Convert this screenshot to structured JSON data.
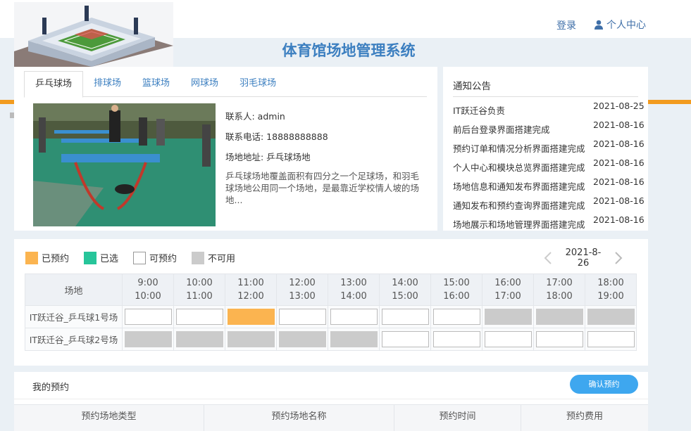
{
  "header": {
    "site_title": "体育馆场地管理系统",
    "login_label": "登录",
    "user_center_label": "个人中心"
  },
  "venue": {
    "tabs": [
      {
        "label": "乒乓球场",
        "active": true
      },
      {
        "label": "排球场",
        "active": false
      },
      {
        "label": "篮球场",
        "active": false
      },
      {
        "label": "网球场",
        "active": false
      },
      {
        "label": "羽毛球场",
        "active": false
      }
    ],
    "contact": "联系人: admin",
    "phone": "联系电话: 18888888888",
    "address": "场地地址: 乒乓球场地",
    "description": "乒乓球场地覆盖面积有四分之一个足球场，和羽毛球场地公用同一个场地，是最靠近学校情人坡的场地..."
  },
  "notices": {
    "title": "通知公告",
    "items": [
      {
        "text": "IT跃迁谷负责",
        "date": "2021-08-25"
      },
      {
        "text": "前后台登录界面搭建完成",
        "date": "2021-08-16"
      },
      {
        "text": "预约订单和情况分析界面搭建完成",
        "date": "2021-08-16"
      },
      {
        "text": "个人中心和模块总览界面搭建完成",
        "date": "2021-08-16"
      },
      {
        "text": "场地信息和通知发布界面搭建完成",
        "date": "2021-08-16"
      },
      {
        "text": "通知发布和预约查询界面搭建完成",
        "date": "2021-08-16"
      },
      {
        "text": "场地展示和场地管理界面搭建完成",
        "date": "2021-08-16"
      }
    ]
  },
  "booking": {
    "legend": [
      {
        "label": "已预约",
        "color": "#fbb450",
        "border": "#fbb450"
      },
      {
        "label": "已选",
        "color": "#27c59a",
        "border": "#27c59a"
      },
      {
        "label": "可预约",
        "color": "#ffffff",
        "border": "#999999"
      },
      {
        "label": "不可用",
        "color": "#cbcbcb",
        "border": "#cbcbcb"
      }
    ],
    "date": "2021-8-26",
    "site_header": "场地",
    "slots": [
      {
        "start": "9:00",
        "end": "10:00"
      },
      {
        "start": "10:00",
        "end": "11:00"
      },
      {
        "start": "11:00",
        "end": "12:00"
      },
      {
        "start": "12:00",
        "end": "13:00"
      },
      {
        "start": "13:00",
        "end": "14:00"
      },
      {
        "start": "14:00",
        "end": "15:00"
      },
      {
        "start": "15:00",
        "end": "16:00"
      },
      {
        "start": "16:00",
        "end": "17:00"
      },
      {
        "start": "17:00",
        "end": "18:00"
      },
      {
        "start": "18:00",
        "end": "19:00"
      }
    ],
    "rows": [
      {
        "name": "IT跃迁谷_乒乓球1号场",
        "status": [
          "open",
          "open",
          "booked",
          "open",
          "open",
          "open",
          "open",
          "unavail",
          "unavail",
          "unavail"
        ]
      },
      {
        "name": "IT跃迁谷_乒乓球2号场",
        "status": [
          "unavail",
          "unavail",
          "unavail",
          "unavail",
          "unavail",
          "open",
          "open",
          "open",
          "open",
          "open"
        ]
      }
    ]
  },
  "my_booking": {
    "title": "我的预约",
    "confirm_label": "确认预约",
    "columns": [
      "预约场地类型",
      "预约场地名称",
      "预约时间",
      "预约费用"
    ]
  },
  "colors": {
    "accent": "#3c7fc0",
    "button": "#3ea7ef",
    "stripe": "#f29b1f"
  }
}
